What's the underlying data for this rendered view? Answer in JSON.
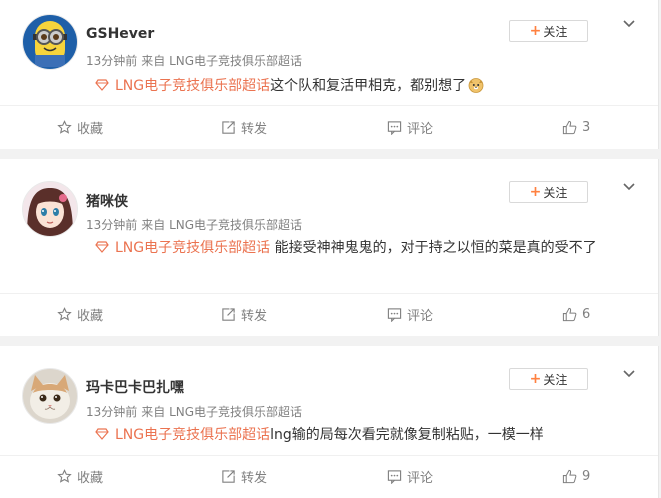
{
  "comments": [
    {
      "user": "GSHever",
      "time": "13分钟前",
      "source": "来自 LNG电子竞技俱乐部超话",
      "follow_label": "关注",
      "tag": "LNG电子竞技俱乐部超话",
      "text": "这个队和复活甲相克，都别想了",
      "actions": {
        "fav": "收藏",
        "repost": "转发",
        "comment": "评论",
        "likes": "3"
      }
    },
    {
      "user": "猪咪侠",
      "time": "13分钟前",
      "source": "来自 LNG电子竞技俱乐部超话",
      "follow_label": "关注",
      "tag": "LNG电子竞技俱乐部超话",
      "text": " 能接受神神鬼鬼的，对于持之以恒的菜是真的受不了",
      "actions": {
        "fav": "收藏",
        "repost": "转发",
        "comment": "评论",
        "likes": "6"
      }
    },
    {
      "user": "玛卡巴卡巴扎嘿",
      "time": "13分钟前",
      "source": "来自 LNG电子竞技俱乐部超话",
      "follow_label": "关注",
      "tag": "LNG电子竞技俱乐部超话",
      "text": "lng输的局每次看完就像复制粘贴，一模一样",
      "actions": {
        "fav": "收藏",
        "repost": "转发",
        "comment": "评论",
        "likes": "9"
      }
    }
  ],
  "colors": {
    "tag": "#eb7350",
    "follow_plus": "#ff8140",
    "muted": "#808080"
  }
}
